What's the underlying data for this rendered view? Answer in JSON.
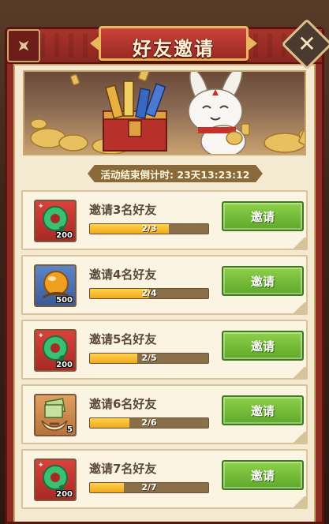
{
  "dialog": {
    "title": "好友邀请",
    "close_label": "✕",
    "countdown": "活动结束倒计时: 23天13:23:12"
  },
  "colors": {
    "panel_red": "#8e2b22",
    "parchment": "#f4ead2",
    "button_green": "#6cb832",
    "progress_gold": "#f0a820"
  },
  "tasks": [
    {
      "label": "邀请3名好友",
      "progress_text": "2/3",
      "progress": 0.667,
      "reward_icon": "green-jade-icon",
      "reward_count": "200",
      "button": "邀请",
      "icon_color": "red"
    },
    {
      "label": "邀请4名好友",
      "progress_text": "2/4",
      "progress": 0.5,
      "reward_icon": "orange-orb-icon",
      "reward_count": "500",
      "button": "邀请",
      "icon_color": "blue"
    },
    {
      "label": "邀请5名好友",
      "progress_text": "2/5",
      "progress": 0.4,
      "reward_icon": "green-jade-icon",
      "reward_count": "200",
      "button": "邀请",
      "icon_color": "red"
    },
    {
      "label": "邀请6名好友",
      "progress_text": "2/6",
      "progress": 0.333,
      "reward_icon": "money-bundle-icon",
      "reward_count": "5",
      "button": "邀请",
      "icon_color": "orange"
    },
    {
      "label": "邀请7名好友",
      "progress_text": "2/7",
      "progress": 0.286,
      "reward_icon": "green-jade-icon",
      "reward_count": "200",
      "button": "邀请",
      "icon_color": "red"
    }
  ]
}
